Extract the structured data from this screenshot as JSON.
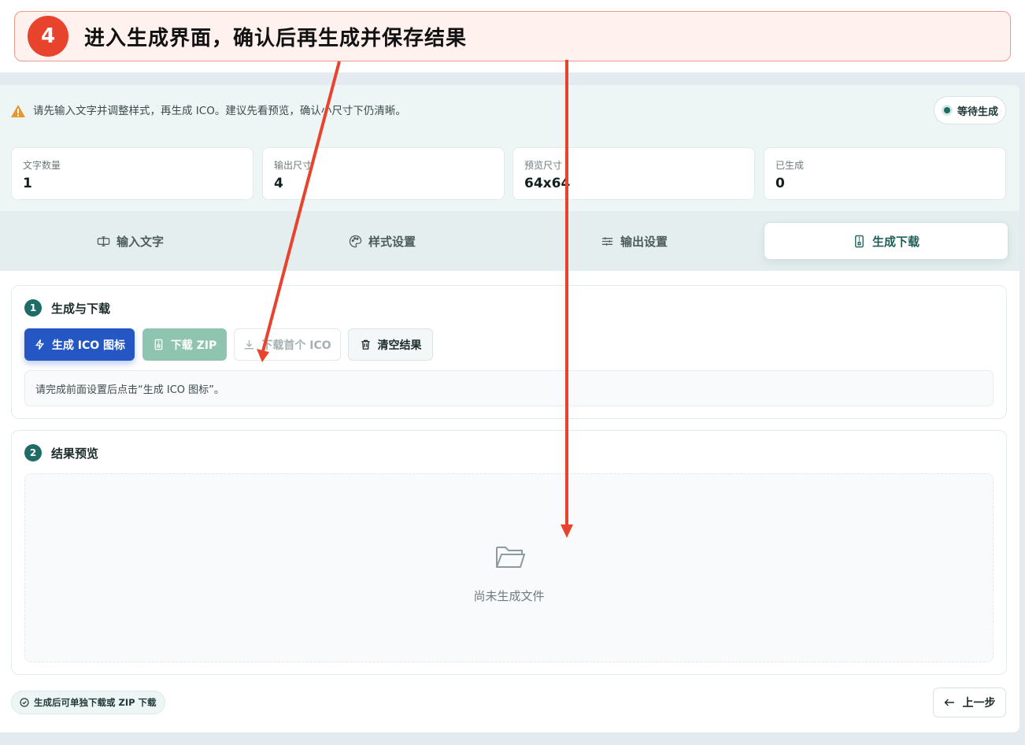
{
  "banner": {
    "number": "4",
    "text": "进入生成界面，确认后再生成并保存结果"
  },
  "notice": {
    "text": "请先输入文字并调整样式，再生成 ICO。建议先看预览，确认小尺寸下仍清晰。"
  },
  "status": {
    "label": "等待生成"
  },
  "stats": [
    {
      "label": "文字数量",
      "value": "1"
    },
    {
      "label": "输出尺寸",
      "value": "4"
    },
    {
      "label": "预览尺寸",
      "value": "64x64"
    },
    {
      "label": "已生成",
      "value": "0"
    }
  ],
  "tabs": [
    {
      "label": "输入文字",
      "icon": "text-input-icon"
    },
    {
      "label": "样式设置",
      "icon": "palette-icon"
    },
    {
      "label": "输出设置",
      "icon": "sliders-icon"
    },
    {
      "label": "生成下载",
      "icon": "file-zip-icon",
      "active": true
    }
  ],
  "section_generate": {
    "step": "1",
    "title": "生成与下载",
    "buttons": {
      "generate": "生成 ICO 图标",
      "download_zip": "下载 ZIP",
      "download_first": "下载首个 ICO",
      "clear": "清空结果"
    },
    "hint": "请完成前面设置后点击“生成 ICO 图标”。"
  },
  "section_preview": {
    "step": "2",
    "title": "结果预览",
    "empty_text": "尚未生成文件"
  },
  "footer": {
    "badge": "生成后可单独下载或 ZIP 下载",
    "back_label": "上一步"
  },
  "colors": {
    "accent": "#1f6b66",
    "primary_button": "#2456c4",
    "annotation": "#e8432c"
  }
}
